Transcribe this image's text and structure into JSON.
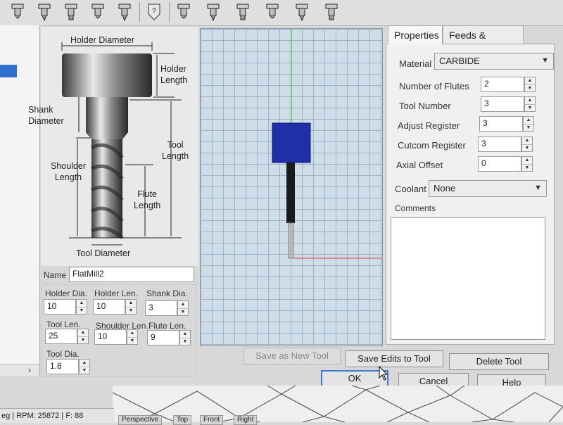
{
  "toolbar": {
    "icons": [
      "tool-holder-icon",
      "tool-tap-icon",
      "tool-tap2-icon",
      "tool-drill-icon",
      "tool-ball-icon",
      "tool-unknown-icon",
      "tool-endmill-icon",
      "tool-endmill2-icon",
      "tool-chamfer-icon",
      "tool-flat-icon",
      "tool-bull-icon",
      "tool-taper-icon"
    ]
  },
  "drawing": {
    "holder_diameter": "Holder Diameter",
    "holder_length": "Holder\nLength",
    "shank_diameter": "Shank\nDiameter",
    "tool_length": "Tool\nLength",
    "shoulder_length": "Shoulder\nLength",
    "flute_length": "Flute\nLength",
    "tool_diameter": "Tool Diameter"
  },
  "name_field": {
    "label": "Name",
    "value": "FlatMill2"
  },
  "dims": {
    "holder_dia": {
      "label": "Holder Dia.",
      "value": "10"
    },
    "holder_len": {
      "label": "Holder Len.",
      "value": "10"
    },
    "shank_dia": {
      "label": "Shank Dia.",
      "value": "3"
    },
    "tool_len": {
      "label": "Tool Len.",
      "value": "25"
    },
    "shoulder_len": {
      "label": "Shoulder Len.",
      "value": "10"
    },
    "flute_len": {
      "label": "Flute Len.",
      "value": "9"
    },
    "tool_dia": {
      "label": "Tool Dia.",
      "value": "1.8"
    }
  },
  "tabs": {
    "properties": "Properties",
    "feeds": "Feeds & Speeds"
  },
  "properties": {
    "material_label": "Material",
    "material_value": "CARBIDE",
    "flutes_label": "Number of Flutes",
    "flutes_value": "2",
    "tool_number_label": "Tool Number",
    "tool_number_value": "3",
    "adjust_label": "Adjust Register",
    "adjust_value": "3",
    "cutcom_label": "Cutcom Register",
    "cutcom_value": "3",
    "axial_label": "Axial Offset",
    "axial_value": "0",
    "coolant_label": "Coolant",
    "coolant_value": "None",
    "comments_label": "Comments",
    "comments_value": ""
  },
  "buttons": {
    "save_new": "Save as New Tool",
    "save_edits": "Save Edits to Tool",
    "delete": "Delete Tool",
    "ok": "OK",
    "cancel": "Cancel",
    "help": "Help"
  },
  "status": {
    "text": "eg | RPM: 25872 | F: 88"
  },
  "bottom_tabs": [
    "Perspective",
    "Top",
    "Front",
    "Right"
  ],
  "colors": {
    "holder_blue": "#1e2fa8",
    "axis_green": "#40c040",
    "axis_red": "#e04040",
    "default_button_border": "#3c7ad6"
  }
}
